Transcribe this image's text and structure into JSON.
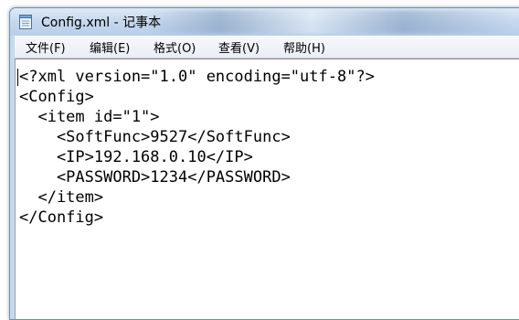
{
  "window": {
    "title": "Config.xml - 记事本"
  },
  "menu": {
    "items": [
      "文件(F)",
      "编辑(E)",
      "格式(O)",
      "查看(V)",
      "帮助(H)"
    ]
  },
  "editor": {
    "lines": [
      "<?xml version=\"1.0\" encoding=\"utf-8\"?>",
      "<Config>",
      "  <item id=\"1\">",
      "    <SoftFunc>9527</SoftFunc>",
      "    <IP>192.168.0.10</IP>",
      "    <PASSWORD>1234</PASSWORD>",
      "  </item>",
      "</Config>"
    ]
  },
  "icons": {
    "app": "notepad-icon"
  },
  "colors": {
    "titlebar": "#c3d6ed",
    "frame": "#c9d9ec",
    "menubar": "#eef2f7"
  }
}
